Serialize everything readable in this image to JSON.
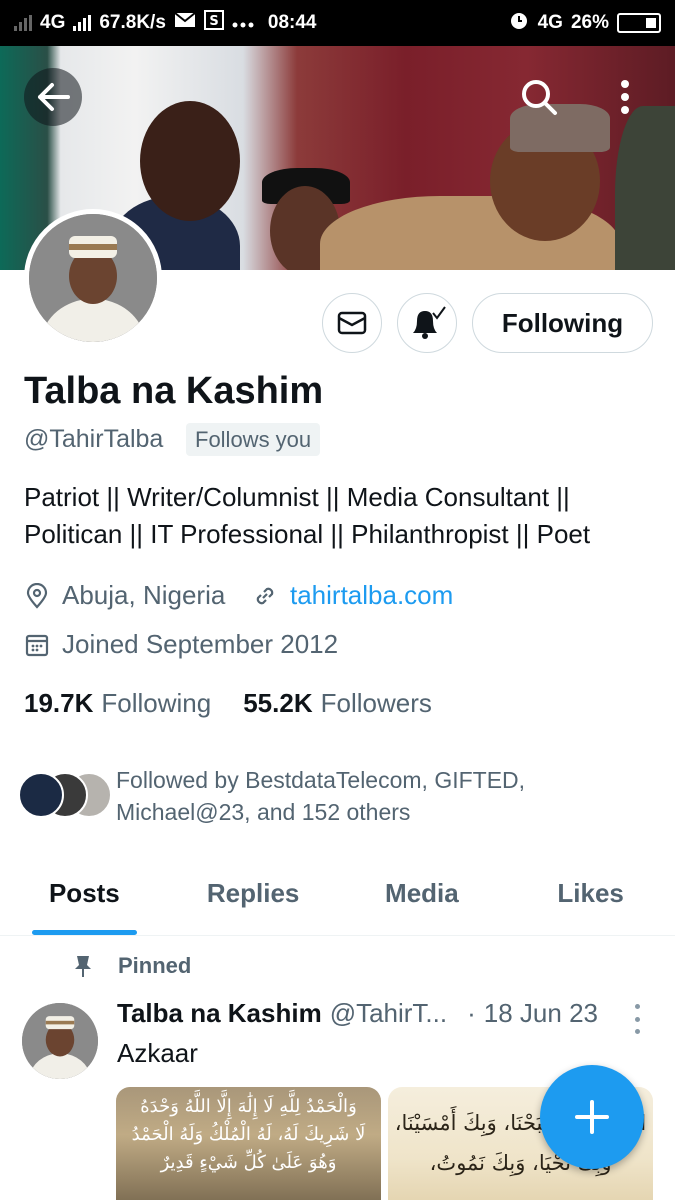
{
  "status_bar": {
    "network": "4G",
    "speed": "67.8K/s",
    "time": "08:44",
    "network2": "4G",
    "battery": "26%"
  },
  "header": {
    "back_icon": "arrow-left-icon",
    "search_icon": "search-icon",
    "more_icon": "more-vertical-icon"
  },
  "profile": {
    "name": "Talba na Kashim",
    "handle": "@TahirTalba",
    "follows_you": "Follows you",
    "bio": "Patriot || Writer/Columnist || Media Consultant || Politican || IT Professional || Philanthropist || Poet",
    "location": "Abuja, Nigeria",
    "website": "tahirtalba.com",
    "joined": "Joined September 2012",
    "following_count": "19.7K",
    "following_label": "Following",
    "followers_count": "55.2K",
    "followers_label": "Followers",
    "followed_by": "Followed by BestdataTelecom, GIFTED, Michael@23, and 152 others"
  },
  "actions": {
    "following_button": "Following",
    "accent": "#1d9bf0"
  },
  "tabs": [
    {
      "label": "Posts",
      "active": true
    },
    {
      "label": "Replies",
      "active": false
    },
    {
      "label": "Media",
      "active": false
    },
    {
      "label": "Likes",
      "active": false
    }
  ],
  "pinned_post": {
    "pinned_label": "Pinned",
    "author": "Talba na Kashim",
    "handle": "@TahirT...",
    "dot": "·",
    "date": "18 Jun 23",
    "text": "Azkaar",
    "image1_lines": [
      "وَالْحَمْدُ لِلَّهِ لَا إِلَٰهَ إِلَّا اللَّهُ وَحْدَهُ",
      "لَا شَرِيكَ لَهُ، لَهُ الْمُلْكُ وَلَهُ الْحَمْدُ",
      "وَهُوَ عَلَىٰ كُلِّ شَيْءٍ قَدِيرٌ"
    ],
    "image2_lines": [
      "اللَّهُمَّ بِكَ أَصْبَحْنَا، وَبِكَ أَمْسَيْنَا،",
      "وَبِكَ نَحْيَا، وَبِكَ نَمُوتُ،"
    ]
  },
  "fab": {
    "icon": "plus-icon"
  }
}
